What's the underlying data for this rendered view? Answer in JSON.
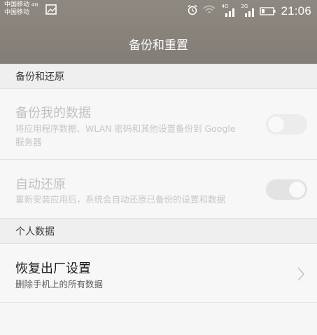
{
  "status_bar": {
    "carrier_1": "中国移动",
    "carrier_1_network": "4G",
    "carrier_2": "中国移动",
    "signal_1_label": "4G",
    "signal_2_label": "2G",
    "time": "21:06",
    "icons": [
      "image-icon",
      "alarm-icon",
      "wifi-icon",
      "signal-icon",
      "signal-icon",
      "battery-icon"
    ]
  },
  "header": {
    "title": "备份和重置"
  },
  "sections": {
    "backup": {
      "label": "备份和还原",
      "items": [
        {
          "title": "备份我的数据",
          "subtitle": "将应用程序数据、WLAN 密码和其他设置备份到 Google 服务器",
          "toggle": "off",
          "enabled": false
        },
        {
          "title": "自动还原",
          "subtitle": "重新安装应用后，系统会自动还原已备份的设置和数据",
          "toggle": "on",
          "enabled": false
        }
      ]
    },
    "personal": {
      "label": "个人数据",
      "items": [
        {
          "title": "恢复出厂设置",
          "subtitle": "删除手机上的所有数据",
          "icon": "chevron-right-icon"
        }
      ]
    }
  },
  "colors": {
    "title_bar": "#857f78",
    "background": "#f6f6f6",
    "section_header": "#efefef",
    "disabled_text": "#c1c1c1"
  }
}
